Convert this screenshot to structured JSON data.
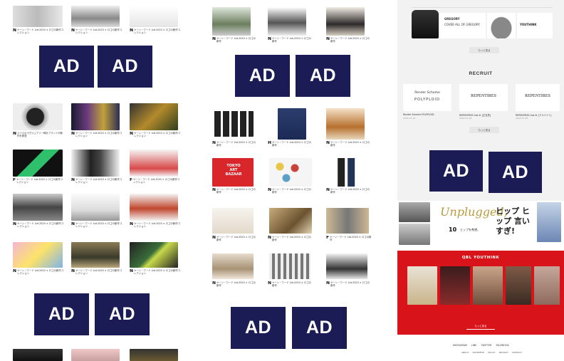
{
  "ad_label": "AD",
  "recruit": {
    "heading": "RECRUIT",
    "more_label": "もっと見る",
    "cards": [
      {
        "logo_line1": "Render Scheme",
        "logo_line2": "POLYPLOID",
        "caption": "Render Scheme POLYPLOID",
        "date": "2020.11.18"
      },
      {
        "logo_line1": "REPENTIRES",
        "logo_line2": "",
        "caption": "REPENTIRES Inst.ft. [正社員]",
        "date": "2020.11.18"
      },
      {
        "logo_line1": "REPENTIRES",
        "logo_line2": "",
        "caption": "REPENTIRES Inst.ft. [アルバイト]",
        "date": "2020.11.18"
      }
    ]
  },
  "top_banners": {
    "gregory_line1": "GREGORY",
    "gregory_line2": "COVER ALL OF GREGORY",
    "newbalance": "YOUTHINK",
    "more_label": "もっと見る"
  },
  "unplugged": {
    "logo": "Unplugged,",
    "big_text": "ヒップ ヒップ 言いすぎ!",
    "number": "10",
    "subtext": "ヒップを希望。"
  },
  "youthink": {
    "heading": "QBL YOUTHINK",
    "more_label": "もっと見る"
  },
  "footer": {
    "social": [
      "INSTAGRAM",
      "LINE",
      "TWITTER",
      "FACEBOOK"
    ],
    "links": [
      "ABOUT",
      "ADVERTISE",
      "POLICY",
      "RECRUIT",
      "CONTACT"
    ]
  },
  "col1_letters": [
    "N",
    "N",
    "N",
    "N",
    "N",
    "N",
    "F",
    "N",
    "F",
    "N",
    "N",
    "N",
    "N",
    "N",
    "N"
  ],
  "col2_letters": [
    "N",
    "N",
    "N",
    "N",
    "H",
    "N",
    "N",
    "N",
    "N",
    "N",
    "N",
    "F",
    "N",
    "N",
    "N"
  ]
}
